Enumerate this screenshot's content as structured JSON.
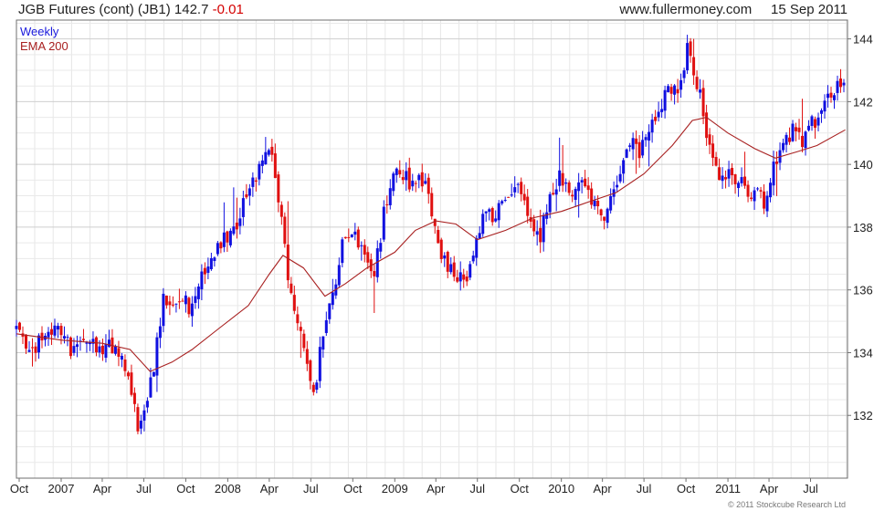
{
  "header": {
    "title": "JGB Futures (cont) (JB1)",
    "last": "142.7",
    "change": "-0.01",
    "site": "www.fullermoney.com",
    "date": "15 Sep 2011"
  },
  "copyright": "© 2011 Stockcube Research Ltd",
  "colors": {
    "up": "#1010e0",
    "down": "#e01010",
    "ema": "#a82020",
    "grid": "#dcdcdc",
    "frame": "#6f6f6f"
  },
  "chart_data": {
    "type": "candlestick",
    "frequency": "Weekly",
    "ylim": [
      130.0,
      144.6
    ],
    "yticks": [
      132,
      134,
      136,
      138,
      140,
      142,
      144
    ],
    "x_range": [
      "2006-09-25",
      "2011-09-20"
    ],
    "x_ticks": [
      {
        "date": "2006-10-01",
        "label": "Oct"
      },
      {
        "date": "2007-01-01",
        "label": "2007"
      },
      {
        "date": "2007-04-01",
        "label": "Apr"
      },
      {
        "date": "2007-07-01",
        "label": "Jul"
      },
      {
        "date": "2007-10-01",
        "label": "Oct"
      },
      {
        "date": "2008-01-01",
        "label": "2008"
      },
      {
        "date": "2008-04-01",
        "label": "Apr"
      },
      {
        "date": "2008-07-01",
        "label": "Jul"
      },
      {
        "date": "2008-10-01",
        "label": "Oct"
      },
      {
        "date": "2009-01-01",
        "label": "2009"
      },
      {
        "date": "2009-04-01",
        "label": "Apr"
      },
      {
        "date": "2009-07-01",
        "label": "Jul"
      },
      {
        "date": "2009-10-01",
        "label": "Oct"
      },
      {
        "date": "2010-01-01",
        "label": "2010"
      },
      {
        "date": "2010-04-01",
        "label": "Apr"
      },
      {
        "date": "2010-07-01",
        "label": "Jul"
      },
      {
        "date": "2010-10-01",
        "label": "Oct"
      },
      {
        "date": "2011-01-01",
        "label": "2011"
      },
      {
        "date": "2011-04-01",
        "label": "Apr"
      },
      {
        "date": "2011-07-01",
        "label": "Jul"
      }
    ],
    "close_path": [
      [
        "2006-09-25",
        134.8
      ],
      [
        "2006-10-20",
        133.8
      ],
      [
        "2006-11-20",
        134.5
      ],
      [
        "2006-12-20",
        134.9
      ],
      [
        "2007-01-25",
        134.1
      ],
      [
        "2007-02-20",
        134.5
      ],
      [
        "2007-03-20",
        134.1
      ],
      [
        "2007-04-20",
        134.3
      ],
      [
        "2007-05-15",
        133.6
      ],
      [
        "2007-06-05",
        132.6
      ],
      [
        "2007-06-20",
        131.6
      ],
      [
        "2007-07-10",
        132.4
      ],
      [
        "2007-07-25",
        133.8
      ],
      [
        "2007-08-15",
        135.9
      ],
      [
        "2007-09-05",
        135.2
      ],
      [
        "2007-09-25",
        135.7
      ],
      [
        "2007-10-15",
        135.3
      ],
      [
        "2007-11-05",
        136.5
      ],
      [
        "2007-12-01",
        137.1
      ],
      [
        "2007-12-25",
        137.6
      ],
      [
        "2008-01-20",
        138.1
      ],
      [
        "2008-02-10",
        139.0
      ],
      [
        "2008-03-05",
        139.6
      ],
      [
        "2008-03-20",
        140.6
      ],
      [
        "2008-04-05",
        140.2
      ],
      [
        "2008-04-25",
        138.6
      ],
      [
        "2008-05-15",
        136.2
      ],
      [
        "2008-06-10",
        134.6
      ],
      [
        "2008-06-25",
        133.6
      ],
      [
        "2008-07-10",
        132.4
      ],
      [
        "2008-07-25",
        134.6
      ],
      [
        "2008-08-20",
        136.0
      ],
      [
        "2008-09-10",
        137.5
      ],
      [
        "2008-10-01",
        137.8
      ],
      [
        "2008-10-25",
        137.4
      ],
      [
        "2008-11-15",
        136.3
      ],
      [
        "2008-12-10",
        138.6
      ],
      [
        "2008-12-25",
        139.6
      ],
      [
        "2009-01-15",
        139.8
      ],
      [
        "2009-02-10",
        139.3
      ],
      [
        "2009-03-05",
        139.6
      ],
      [
        "2009-03-25",
        138.4
      ],
      [
        "2009-04-15",
        137.0
      ],
      [
        "2009-05-10",
        136.6
      ],
      [
        "2009-06-05",
        136.3
      ],
      [
        "2009-06-25",
        137.1
      ],
      [
        "2009-07-15",
        138.6
      ],
      [
        "2009-08-10",
        138.3
      ],
      [
        "2009-09-05",
        139.1
      ],
      [
        "2009-09-25",
        139.3
      ],
      [
        "2009-10-20",
        138.3
      ],
      [
        "2009-11-15",
        137.7
      ],
      [
        "2009-12-05",
        139.0
      ],
      [
        "2009-12-25",
        139.6
      ],
      [
        "2010-01-20",
        139.1
      ],
      [
        "2010-02-15",
        139.6
      ],
      [
        "2010-03-10",
        138.9
      ],
      [
        "2010-04-05",
        138.4
      ],
      [
        "2010-04-25",
        139.3
      ],
      [
        "2010-05-15",
        140.1
      ],
      [
        "2010-06-05",
        140.6
      ],
      [
        "2010-06-25",
        140.4
      ],
      [
        "2010-07-15",
        141.1
      ],
      [
        "2010-08-05",
        141.9
      ],
      [
        "2010-08-25",
        142.6
      ],
      [
        "2010-09-15",
        142.2
      ],
      [
        "2010-10-05",
        143.7
      ],
      [
        "2010-10-20",
        143.0
      ],
      [
        "2010-11-10",
        141.6
      ],
      [
        "2010-11-25",
        140.1
      ],
      [
        "2010-12-15",
        139.5
      ],
      [
        "2011-01-05",
        139.7
      ],
      [
        "2011-01-25",
        139.5
      ],
      [
        "2011-02-15",
        139.0
      ],
      [
        "2011-03-05",
        139.3
      ],
      [
        "2011-03-25",
        138.7
      ],
      [
        "2011-04-10",
        139.8
      ],
      [
        "2011-05-01",
        140.6
      ],
      [
        "2011-05-25",
        141.1
      ],
      [
        "2011-06-15",
        140.8
      ],
      [
        "2011-07-05",
        141.3
      ],
      [
        "2011-07-25",
        141.6
      ],
      [
        "2011-08-15",
        142.3
      ],
      [
        "2011-09-05",
        142.5
      ],
      [
        "2011-09-15",
        142.7
      ]
    ],
    "ema_path": [
      [
        "2006-09-25",
        134.6
      ],
      [
        "2007-01-01",
        134.4
      ],
      [
        "2007-04-01",
        134.3
      ],
      [
        "2007-06-01",
        134.1
      ],
      [
        "2007-07-15",
        133.4
      ],
      [
        "2007-09-01",
        133.7
      ],
      [
        "2007-10-15",
        134.1
      ],
      [
        "2007-12-15",
        134.8
      ],
      [
        "2008-02-15",
        135.5
      ],
      [
        "2008-04-01",
        136.5
      ],
      [
        "2008-05-01",
        137.1
      ],
      [
        "2008-06-15",
        136.7
      ],
      [
        "2008-08-01",
        135.8
      ],
      [
        "2008-09-15",
        136.2
      ],
      [
        "2008-11-01",
        136.7
      ],
      [
        "2009-01-01",
        137.2
      ],
      [
        "2009-02-15",
        137.9
      ],
      [
        "2009-04-01",
        138.2
      ],
      [
        "2009-05-15",
        138.1
      ],
      [
        "2009-07-01",
        137.6
      ],
      [
        "2009-09-01",
        137.9
      ],
      [
        "2009-11-01",
        138.3
      ],
      [
        "2010-01-01",
        138.5
      ],
      [
        "2010-03-01",
        138.8
      ],
      [
        "2010-05-01",
        139.1
      ],
      [
        "2010-07-01",
        139.7
      ],
      [
        "2010-09-01",
        140.6
      ],
      [
        "2010-10-15",
        141.4
      ],
      [
        "2010-11-15",
        141.5
      ],
      [
        "2011-01-01",
        141.0
      ],
      [
        "2011-03-01",
        140.5
      ],
      [
        "2011-04-15",
        140.2
      ],
      [
        "2011-06-01",
        140.4
      ],
      [
        "2011-07-15",
        140.6
      ],
      [
        "2011-09-15",
        141.1
      ]
    ],
    "legend": [
      "Weekly",
      "EMA 200"
    ],
    "legend_position": "top-left"
  }
}
